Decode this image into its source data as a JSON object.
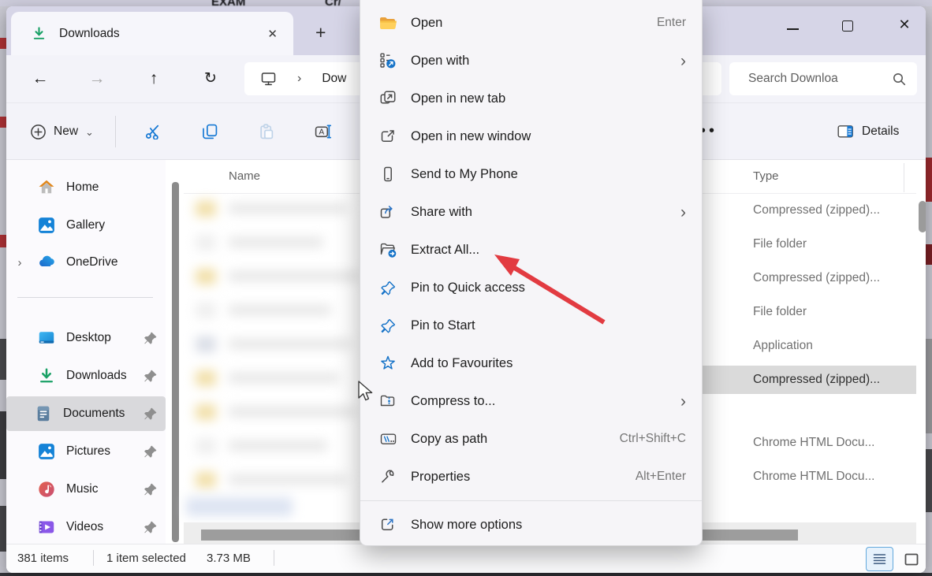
{
  "window": {
    "tab_title": "Downloads",
    "tab_close_glyph": "✕",
    "new_tab_glyph": "+",
    "close_glyph": "✕"
  },
  "navigation": {
    "back_glyph": "←",
    "forward_glyph": "→",
    "up_glyph": "↑",
    "refresh_glyph": "↻",
    "breadcrumb_chevron": "›",
    "breadcrumb_text": "Dow",
    "search_placeholder": "Search Downloa"
  },
  "toolbar": {
    "new_label": "New",
    "new_chevron": "⌄",
    "more_glyph": "••",
    "details_label": "Details"
  },
  "sidebar": {
    "expander_glyph": "›",
    "items": [
      {
        "label": "Home",
        "icon": "home-icon",
        "pinned": false
      },
      {
        "label": "Gallery",
        "icon": "gallery-icon",
        "pinned": false
      },
      {
        "label": "OneDrive",
        "icon": "onedrive-icon",
        "pinned": false,
        "expandable": true
      },
      {
        "label": "Desktop",
        "icon": "desktop-icon",
        "pinned": true
      },
      {
        "label": "Downloads",
        "icon": "downloads-icon",
        "pinned": true
      },
      {
        "label": "Documents",
        "icon": "documents-icon",
        "pinned": true,
        "selected": true
      },
      {
        "label": "Pictures",
        "icon": "pictures-icon",
        "pinned": true
      },
      {
        "label": "Music",
        "icon": "music-icon",
        "pinned": true
      },
      {
        "label": "Videos",
        "icon": "videos-icon",
        "pinned": true
      }
    ]
  },
  "file_list": {
    "name_header": "Name",
    "type_header": "Type",
    "type_values": [
      "Compressed (zipped)...",
      "File folder",
      "Compressed (zipped)...",
      "File folder",
      "Application",
      "Compressed (zipped)...",
      "Chrome HTML Docu...",
      "Chrome HTML Docu..."
    ],
    "selected_index": 5
  },
  "context_menu": {
    "submenu_glyph": "›",
    "items": [
      {
        "label": "Open",
        "shortcut": "Enter",
        "icon": "folder-open-icon"
      },
      {
        "label": "Open with",
        "icon": "open-with-icon",
        "submenu": true
      },
      {
        "label": "Open in new tab",
        "icon": "open-new-tab-icon"
      },
      {
        "label": "Open in new window",
        "icon": "open-new-window-icon"
      },
      {
        "label": "Send to My Phone",
        "icon": "phone-icon"
      },
      {
        "label": "Share with",
        "icon": "share-icon",
        "submenu": true
      },
      {
        "label": "Extract All...",
        "icon": "extract-all-icon"
      },
      {
        "label": "Pin to Quick access",
        "icon": "pin-icon"
      },
      {
        "label": "Pin to Start",
        "icon": "pin-icon"
      },
      {
        "label": "Add to Favourites",
        "icon": "star-icon"
      },
      {
        "label": "Compress to...",
        "icon": "zip-folder-icon",
        "submenu": true
      },
      {
        "label": "Copy as path",
        "shortcut": "Ctrl+Shift+C",
        "icon": "copy-path-icon"
      },
      {
        "label": "Properties",
        "shortcut": "Alt+Enter",
        "icon": "wrench-icon"
      },
      {
        "label": "Show more options",
        "icon": "show-more-icon"
      }
    ]
  },
  "status_bar": {
    "item_count": "381 items",
    "selection_count": "1 item selected",
    "selection_size": "3.73 MB"
  },
  "colors": {
    "titlebar": "#d6d5e7",
    "chrome_bg": "#f3f3f9",
    "accent_blue": "#1779d4",
    "selection_gray": "#dadada",
    "red_arrow": "#e23b41",
    "downloads_green": "#18a065"
  }
}
